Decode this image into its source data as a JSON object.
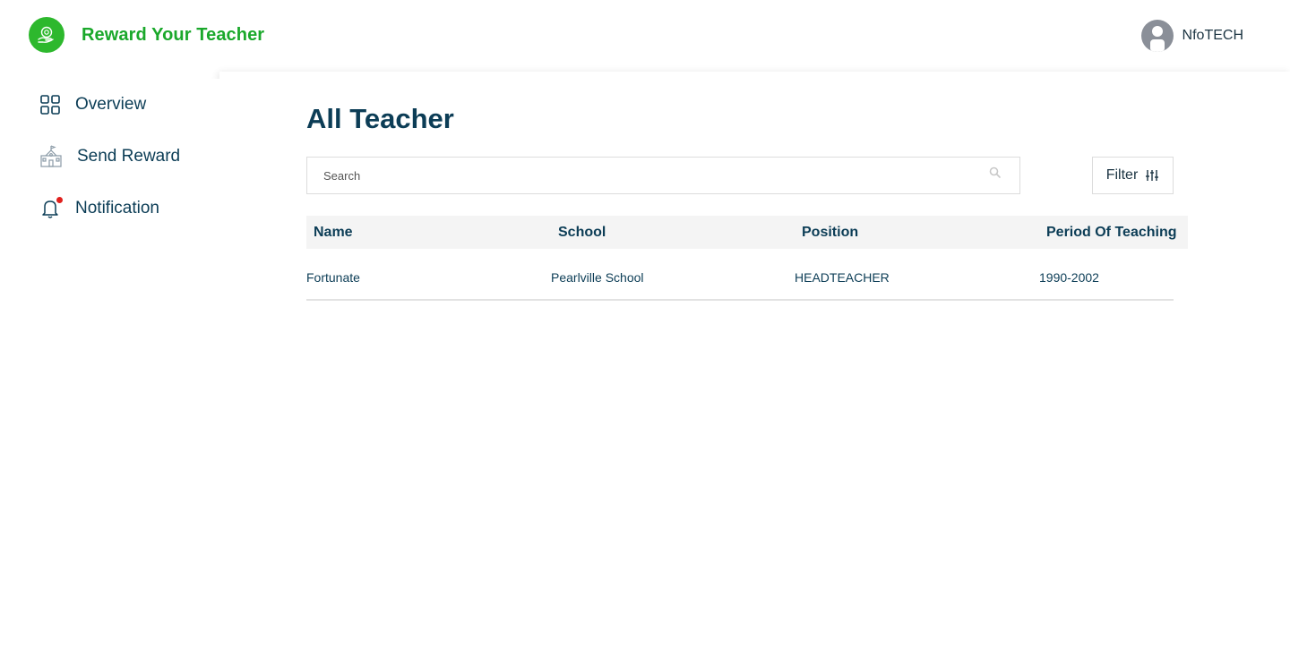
{
  "header": {
    "brand": "Reward Your Teacher",
    "user_name": "NfoTECH",
    "logo_icon": "hand-gift-icon",
    "brand_color": "#1aa82b"
  },
  "sidebar": {
    "items": [
      {
        "label": "Overview",
        "icon": "grid-icon"
      },
      {
        "label": "Send Reward",
        "icon": "school-building-icon"
      },
      {
        "label": "Notification",
        "icon": "bell-icon",
        "has_badge": true
      }
    ]
  },
  "main": {
    "title": "All Teacher",
    "search": {
      "placeholder": "Search",
      "value": ""
    },
    "filter_label": "Filter",
    "table": {
      "headers": [
        "Name",
        "School",
        "Position",
        "Period Of Teaching"
      ],
      "rows": [
        [
          "Fortunate",
          "Pearlville School",
          "HEADTEACHER",
          "1990-2002"
        ]
      ]
    }
  },
  "colors": {
    "primary_text": "#0c3d56",
    "accent_green": "#2db82d",
    "badge_red": "#e0201d"
  }
}
